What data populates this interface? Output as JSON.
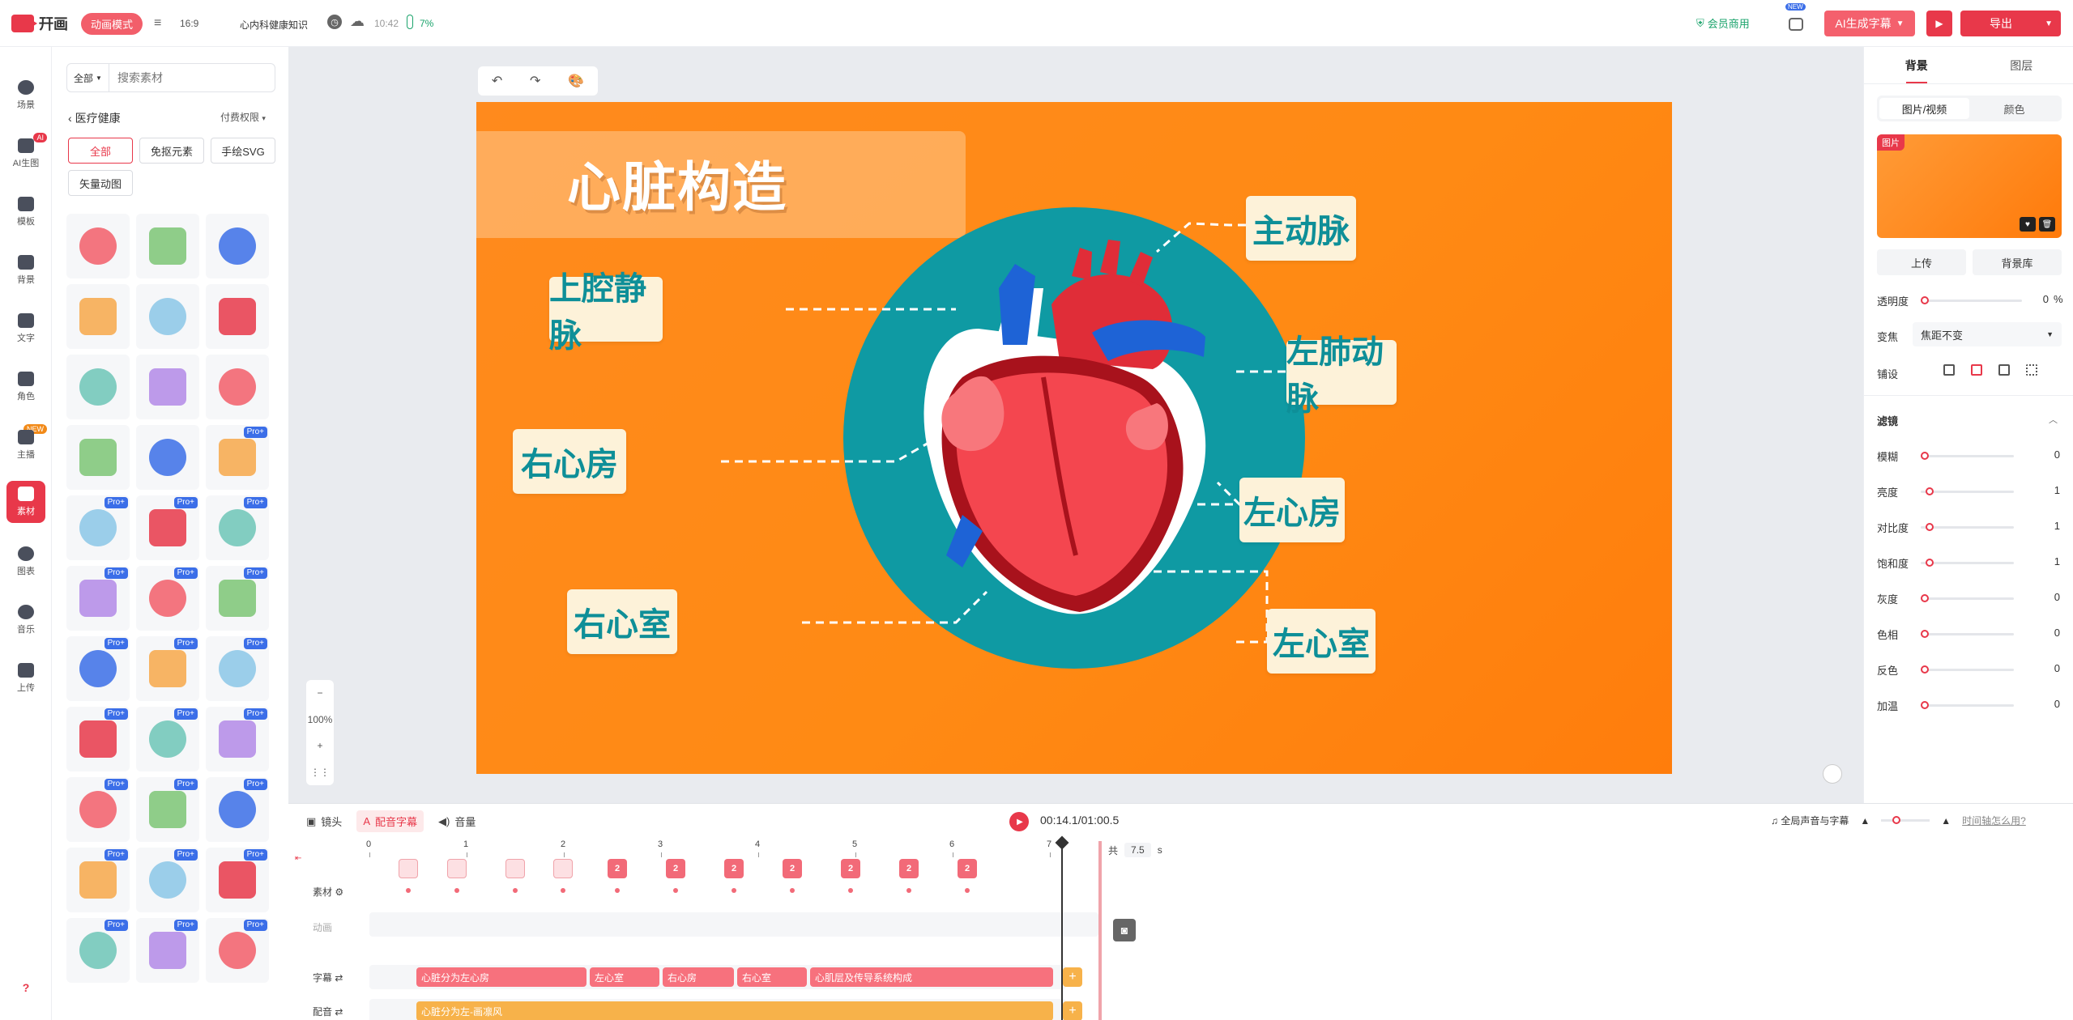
{
  "topbar": {
    "logo_text": "幵画",
    "mode": "动画模式",
    "ratio": "16:9",
    "project_name": "心内科健康知识",
    "time": "10:42",
    "battery": "7%",
    "vip": "会员商用",
    "new_badge": "NEW",
    "ai_subtitle": "AI生成字幕",
    "export": "导出"
  },
  "leftnav": {
    "items": [
      {
        "label": "场景"
      },
      {
        "label": "AI生图",
        "badge": "AI"
      },
      {
        "label": "模板"
      },
      {
        "label": "背景"
      },
      {
        "label": "文字"
      },
      {
        "label": "角色"
      },
      {
        "label": "主播",
        "badge": "NEW"
      },
      {
        "label": "素材"
      },
      {
        "label": "图表"
      },
      {
        "label": "音乐"
      },
      {
        "label": "上传"
      }
    ],
    "help": "?"
  },
  "assets": {
    "search_scope": "全部",
    "search_placeholder": "搜索素材",
    "category": "医疗健康",
    "permission": "付费权限",
    "filters": [
      "全部",
      "免抠元素",
      "手绘SVG",
      "矢量动图"
    ],
    "pro_label": "Pro+",
    "thumbs": [
      {
        "icon": "medicine-bottle-icon",
        "pro": false
      },
      {
        "icon": "virus-icon",
        "pro": false
      },
      {
        "icon": "clipboard-icon",
        "pro": false
      },
      {
        "icon": "heart-pulse-icon",
        "pro": false
      },
      {
        "icon": "heart-sketch-icon",
        "pro": false
      },
      {
        "icon": "bacteria-icon",
        "pro": false
      },
      {
        "icon": "pill-circle-icon",
        "pro": false
      },
      {
        "icon": "stretcher-icon",
        "pro": false
      },
      {
        "icon": "stretcher-icon",
        "pro": false
      },
      {
        "icon": "stretcher-icon",
        "pro": false
      },
      {
        "icon": "stretcher-icon",
        "pro": false
      },
      {
        "icon": "microscope-icon",
        "pro": true
      },
      {
        "icon": "medicine-bag-icon",
        "pro": true
      },
      {
        "icon": "virus-icon",
        "pro": true
      },
      {
        "icon": "ambulance-icon",
        "pro": true
      },
      {
        "icon": "bowl-icon",
        "pro": true
      },
      {
        "icon": "medical-table-icon",
        "pro": true
      },
      {
        "icon": "bandage-icon",
        "pro": true
      },
      {
        "icon": "pills-icon",
        "pro": true
      },
      {
        "icon": "pill-pack-icon",
        "pro": true
      },
      {
        "icon": "medicine-box-icon",
        "pro": true
      },
      {
        "icon": "thermometer-icon",
        "pro": true
      },
      {
        "icon": "stethoscope-heart-icon",
        "pro": true
      },
      {
        "icon": "first-aid-kit-icon",
        "pro": true
      },
      {
        "icon": "bandage-cross-icon",
        "pro": true
      },
      {
        "icon": "note-icon",
        "pro": true
      },
      {
        "icon": "heart-badge-icon",
        "pro": true
      },
      {
        "icon": "bandage-cross-icon",
        "pro": true
      },
      {
        "icon": "syringe-icon",
        "pro": true
      },
      {
        "icon": "cross-circle-icon",
        "pro": true
      },
      {
        "icon": "microscope-icon",
        "pro": true
      },
      {
        "icon": "test-tube-icon",
        "pro": true
      },
      {
        "icon": "monitor-icon",
        "pro": true
      }
    ]
  },
  "canvas": {
    "zoom": "100%",
    "title": "心脏构造",
    "labels": {
      "superior_vena_cava": "上腔静脉",
      "right_atrium": "右心房",
      "right_ventricle": "右心室",
      "aorta": "主动脉",
      "pulmonary_artery": "左肺动脉",
      "left_atrium": "左心房",
      "left_ventricle": "左心室"
    },
    "colors": {
      "background": "#ff8a1d",
      "circle": "#0f9aa3",
      "label_bg": "#fdf2d9",
      "label_text": "#0e8f98"
    }
  },
  "rightpanel": {
    "tabs": [
      "背景",
      "图层"
    ],
    "seg": [
      "图片/视频",
      "颜色"
    ],
    "img_tag": "图片",
    "upload": "上传",
    "library": "背景库",
    "opacity_label": "透明度",
    "opacity_value": "0",
    "opacity_unit": "%",
    "focus_label": "变焦",
    "focus_value": "焦距不变",
    "fill_label": "铺设",
    "filter_label": "滤镜",
    "filters": [
      {
        "label": "模糊",
        "value": "0",
        "level": 0
      },
      {
        "label": "亮度",
        "value": "1",
        "level": 0.05
      },
      {
        "label": "对比度",
        "value": "1",
        "level": 0.05
      },
      {
        "label": "饱和度",
        "value": "1",
        "level": 0.05
      },
      {
        "label": "灰度",
        "value": "0",
        "level": 0
      },
      {
        "label": "色相",
        "value": "0",
        "level": 0
      },
      {
        "label": "反色",
        "value": "0",
        "level": 0
      },
      {
        "label": "加温",
        "value": "0",
        "level": 0
      }
    ]
  },
  "timeline": {
    "tabs": [
      "镜头",
      "配音字幕",
      "音量"
    ],
    "timecode": "00:14.1/01:00.5",
    "global_voice": "全局声音与字幕",
    "help_link": "时间轴怎么用?",
    "ruler": [
      "0",
      "1",
      "2",
      "3",
      "4",
      "5",
      "6",
      "7"
    ],
    "total_prefix": "共",
    "total_value": "7.5",
    "total_unit": "s",
    "row_labels": {
      "asset": "素材",
      "anim": "动画",
      "subtitle": "字幕",
      "voice": "配音"
    },
    "keyframe_numbers": [
      "2",
      "2",
      "2",
      "2",
      "2",
      "2",
      "2"
    ],
    "subtitles": [
      "心脏分为左心房",
      "左心室",
      "右心房",
      "右心室",
      "心肌层及传导系统构成"
    ],
    "voice": "心脏分为左-画凛风",
    "add": "+"
  }
}
